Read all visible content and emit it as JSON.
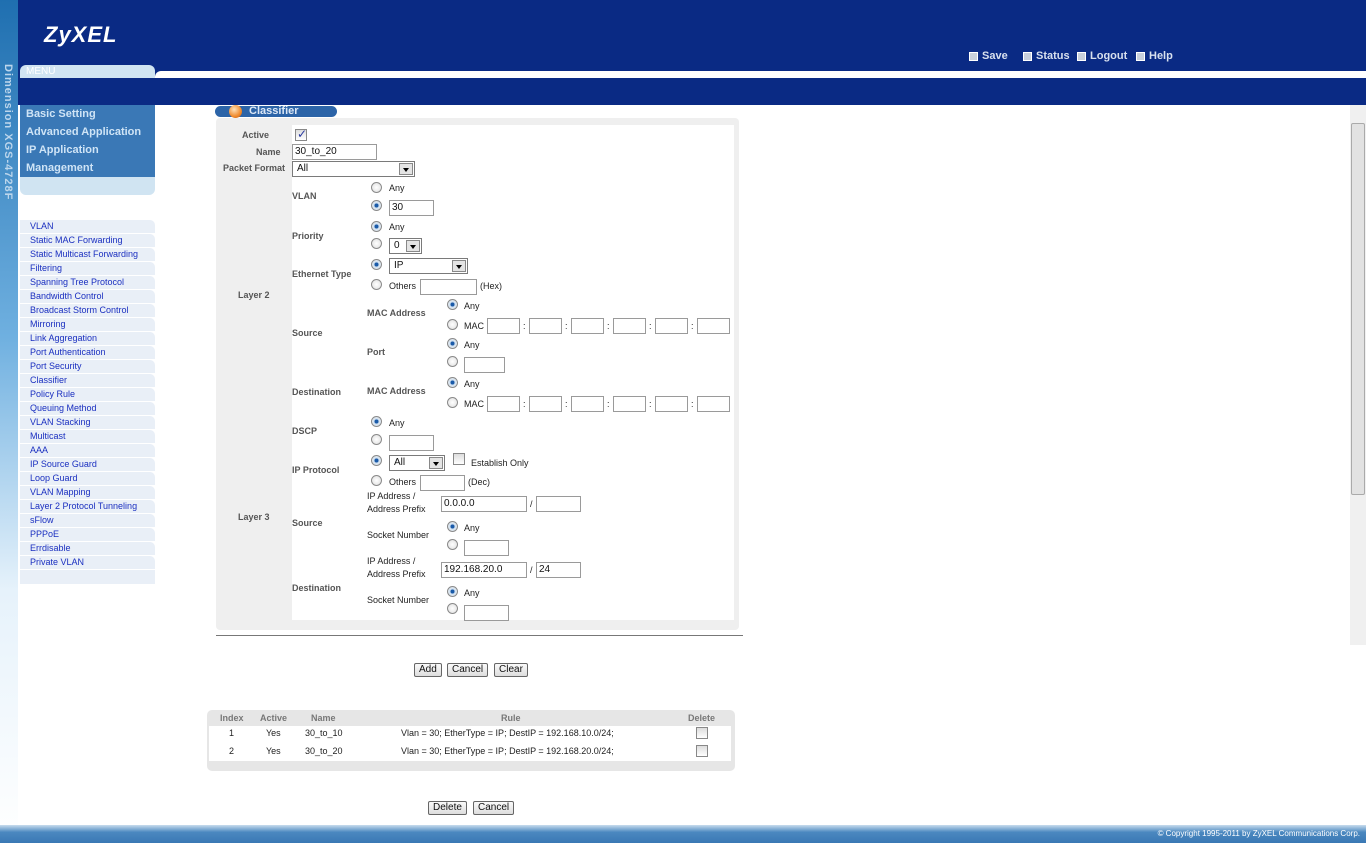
{
  "brand": {
    "logo": "ZyXEL",
    "model_vertical": "Dimension XGS-4728F"
  },
  "header": {
    "menu_label": "MENU",
    "links": [
      {
        "label": "Save",
        "icon": "save-icon"
      },
      {
        "label": "Status",
        "icon": "home-icon"
      },
      {
        "label": "Logout",
        "icon": "lock-icon"
      },
      {
        "label": "Help",
        "icon": "help-icon"
      }
    ]
  },
  "sidebar": {
    "main": [
      "Basic Setting",
      "Advanced Application",
      "IP Application",
      "Management"
    ],
    "sub": [
      "VLAN",
      "Static MAC Forwarding",
      "Static Multicast Forwarding",
      "Filtering",
      "Spanning Tree Protocol",
      "Bandwidth Control",
      "Broadcast Storm Control",
      "Mirroring",
      "Link Aggregation",
      "Port Authentication",
      "Port Security",
      "Classifier",
      "Policy Rule",
      "Queuing Method",
      "VLAN Stacking",
      "Multicast",
      "AAA",
      "IP Source Guard",
      "Loop Guard",
      "VLAN Mapping",
      "Layer 2 Protocol Tunneling",
      "sFlow",
      "PPPoE",
      "Errdisable",
      "Private VLAN"
    ]
  },
  "page": {
    "title": "Classifier"
  },
  "form": {
    "active_label": "Active",
    "active_checked": true,
    "name_label": "Name",
    "name_value": "30_to_20",
    "packet_format_label": "Packet Format",
    "packet_format_value": "All",
    "layer2_label": "Layer 2",
    "layer3_label": "Layer 3",
    "vlan_label": "VLAN",
    "vlan_value": "30",
    "priority_label": "Priority",
    "priority_value": "0",
    "ethertype_label": "Ethernet Type",
    "ethertype_value": "IP",
    "any": "Any",
    "others": "Others",
    "hex": "(Hex)",
    "dec": "(Dec)",
    "mac": "MAC",
    "colon": ":",
    "slash": "/",
    "source_label": "Source",
    "destination_label": "Destination",
    "mac_address_label": "MAC Address",
    "port_label": "Port",
    "dscp_label": "DSCP",
    "ip_protocol_label": "IP Protocol",
    "ip_protocol_value": "All",
    "establish_only": "Establish Only",
    "ip_address_label1": "IP Address /",
    "ip_address_label2": "Address Prefix",
    "src_ip": "0.0.0.0",
    "src_prefix": "",
    "dst_ip": "192.168.20.0",
    "dst_prefix": "24",
    "socket_label": "Socket Number"
  },
  "buttons": {
    "add": "Add",
    "cancel": "Cancel",
    "clear": "Clear",
    "delete": "Delete"
  },
  "table": {
    "headers": [
      "Index",
      "Active",
      "Name",
      "Rule",
      "Delete"
    ],
    "rows": [
      {
        "index": "1",
        "active": "Yes",
        "name": "30_to_10",
        "rule": "Vlan = 30; EtherType = IP; DestIP = 192.168.10.0/24;"
      },
      {
        "index": "2",
        "active": "Yes",
        "name": "30_to_20",
        "rule": "Vlan = 30; EtherType = IP; DestIP = 192.168.20.0/24;"
      }
    ]
  },
  "footer": {
    "copyright": "© Copyright 1995-2011 by ZyXEL Communications Corp."
  },
  "colors": {
    "header": "#0a2a84",
    "menu": "#3a78b6",
    "link": "#1a2fc0"
  }
}
